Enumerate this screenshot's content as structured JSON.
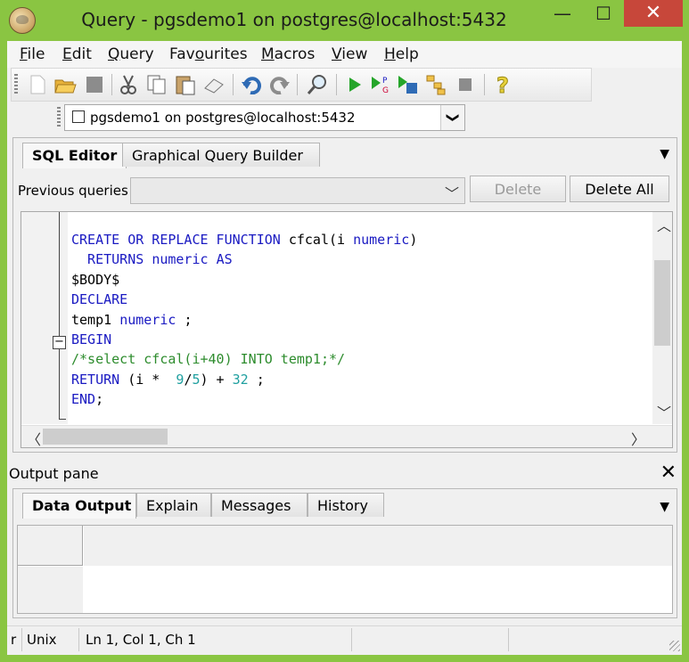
{
  "window": {
    "title": "Query - pgsdemo1 on postgres@localhost:5432",
    "controls": {
      "minimize": "—",
      "maximize": "☐",
      "close": "✕"
    }
  },
  "menu": [
    {
      "label": "File",
      "u": "F",
      "rest": "ile"
    },
    {
      "label": "Edit",
      "u": "E",
      "rest": "dit"
    },
    {
      "label": "Query",
      "u": "Q",
      "rest": "uery"
    },
    {
      "label": "Favourites",
      "pre": "Fav",
      "u": "o",
      "rest": "urites"
    },
    {
      "label": "Macros",
      "u": "M",
      "rest": "acros"
    },
    {
      "label": "View",
      "u": "V",
      "rest": "iew"
    },
    {
      "label": "Help",
      "u": "H",
      "rest": "elp"
    }
  ],
  "toolbar": {
    "icons": [
      "new-file-icon",
      "open-folder-icon",
      "save-icon",
      "cut-icon",
      "copy-icon",
      "paste-icon",
      "clear-icon",
      "undo-icon",
      "redo-icon",
      "find-icon",
      "execute-icon",
      "explain-icon",
      "execute-to-file-icon",
      "explain-analyze-icon",
      "stop-icon",
      "help-icon"
    ]
  },
  "connection": {
    "value": "pgsdemo1 on postgres@localhost:5432",
    "arrow": "❯"
  },
  "sql_tabs": [
    "SQL Editor",
    "Graphical Query Builder"
  ],
  "previous_queries": {
    "label": "Previous queries",
    "value": "",
    "delete": "Delete",
    "delete_all": "Delete All"
  },
  "editor": {
    "lines": [
      [
        {
          "t": "CREATE OR REPLACE FUNCTION ",
          "c": "kw"
        },
        {
          "t": "cfcal(i ",
          "c": ""
        },
        {
          "t": "numeric",
          "c": "kw"
        },
        {
          "t": ")",
          "c": ""
        }
      ],
      [
        {
          "t": "  RETURNS ",
          "c": "kw"
        },
        {
          "t": "numeric ",
          "c": "kw"
        },
        {
          "t": "AS",
          "c": "kw"
        }
      ],
      [
        {
          "t": "$BODY$",
          "c": ""
        }
      ],
      [
        {
          "t": "DECLARE",
          "c": "kw"
        }
      ],
      [
        {
          "t": "temp1 ",
          "c": ""
        },
        {
          "t": "numeric ",
          "c": "kw"
        },
        {
          "t": ";",
          "c": ""
        }
      ],
      [
        {
          "t": "BEGIN",
          "c": "kw"
        }
      ],
      [
        {
          "t": "/*select cfcal(i+40) INTO temp1;*/",
          "c": "cm"
        }
      ],
      [
        {
          "t": "RETURN ",
          "c": "kw"
        },
        {
          "t": "(i *  ",
          "c": ""
        },
        {
          "t": "9",
          "c": "num"
        },
        {
          "t": "/",
          "c": ""
        },
        {
          "t": "5",
          "c": "num"
        },
        {
          "t": ") + ",
          "c": ""
        },
        {
          "t": "32",
          "c": "num"
        },
        {
          "t": " ;",
          "c": ""
        }
      ],
      [
        {
          "t": "END",
          "c": "kw"
        },
        {
          "t": ";",
          "c": ""
        }
      ]
    ]
  },
  "output": {
    "title": "Output pane",
    "close": "✕",
    "tabs": [
      "Data Output",
      "Explain",
      "Messages",
      "History"
    ]
  },
  "status": {
    "first": "r",
    "eol": "Unix",
    "position": "Ln 1, Col 1, Ch 1"
  },
  "colors": {
    "frame": "#8ac542",
    "close": "#c7473a",
    "keyword": "#1a1ac2",
    "comment": "#2d8c2d",
    "number": "#20a0a0"
  }
}
